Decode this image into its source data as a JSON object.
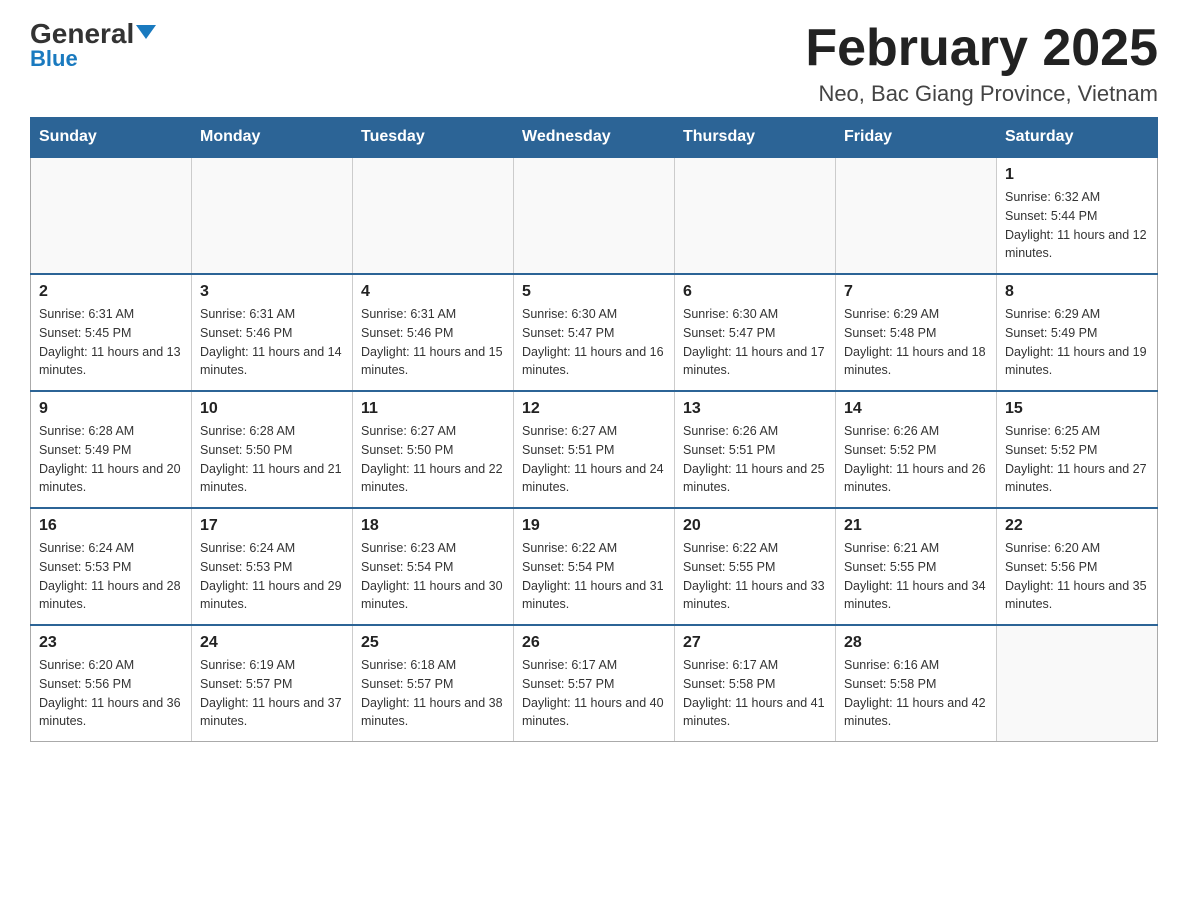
{
  "header": {
    "logo_general": "General",
    "logo_blue": "Blue",
    "title": "February 2025",
    "subtitle": "Neo, Bac Giang Province, Vietnam"
  },
  "days_of_week": [
    "Sunday",
    "Monday",
    "Tuesday",
    "Wednesday",
    "Thursday",
    "Friday",
    "Saturday"
  ],
  "weeks": [
    [
      {
        "day": "",
        "info": ""
      },
      {
        "day": "",
        "info": ""
      },
      {
        "day": "",
        "info": ""
      },
      {
        "day": "",
        "info": ""
      },
      {
        "day": "",
        "info": ""
      },
      {
        "day": "",
        "info": ""
      },
      {
        "day": "1",
        "info": "Sunrise: 6:32 AM\nSunset: 5:44 PM\nDaylight: 11 hours and 12 minutes."
      }
    ],
    [
      {
        "day": "2",
        "info": "Sunrise: 6:31 AM\nSunset: 5:45 PM\nDaylight: 11 hours and 13 minutes."
      },
      {
        "day": "3",
        "info": "Sunrise: 6:31 AM\nSunset: 5:46 PM\nDaylight: 11 hours and 14 minutes."
      },
      {
        "day": "4",
        "info": "Sunrise: 6:31 AM\nSunset: 5:46 PM\nDaylight: 11 hours and 15 minutes."
      },
      {
        "day": "5",
        "info": "Sunrise: 6:30 AM\nSunset: 5:47 PM\nDaylight: 11 hours and 16 minutes."
      },
      {
        "day": "6",
        "info": "Sunrise: 6:30 AM\nSunset: 5:47 PM\nDaylight: 11 hours and 17 minutes."
      },
      {
        "day": "7",
        "info": "Sunrise: 6:29 AM\nSunset: 5:48 PM\nDaylight: 11 hours and 18 minutes."
      },
      {
        "day": "8",
        "info": "Sunrise: 6:29 AM\nSunset: 5:49 PM\nDaylight: 11 hours and 19 minutes."
      }
    ],
    [
      {
        "day": "9",
        "info": "Sunrise: 6:28 AM\nSunset: 5:49 PM\nDaylight: 11 hours and 20 minutes."
      },
      {
        "day": "10",
        "info": "Sunrise: 6:28 AM\nSunset: 5:50 PM\nDaylight: 11 hours and 21 minutes."
      },
      {
        "day": "11",
        "info": "Sunrise: 6:27 AM\nSunset: 5:50 PM\nDaylight: 11 hours and 22 minutes."
      },
      {
        "day": "12",
        "info": "Sunrise: 6:27 AM\nSunset: 5:51 PM\nDaylight: 11 hours and 24 minutes."
      },
      {
        "day": "13",
        "info": "Sunrise: 6:26 AM\nSunset: 5:51 PM\nDaylight: 11 hours and 25 minutes."
      },
      {
        "day": "14",
        "info": "Sunrise: 6:26 AM\nSunset: 5:52 PM\nDaylight: 11 hours and 26 minutes."
      },
      {
        "day": "15",
        "info": "Sunrise: 6:25 AM\nSunset: 5:52 PM\nDaylight: 11 hours and 27 minutes."
      }
    ],
    [
      {
        "day": "16",
        "info": "Sunrise: 6:24 AM\nSunset: 5:53 PM\nDaylight: 11 hours and 28 minutes."
      },
      {
        "day": "17",
        "info": "Sunrise: 6:24 AM\nSunset: 5:53 PM\nDaylight: 11 hours and 29 minutes."
      },
      {
        "day": "18",
        "info": "Sunrise: 6:23 AM\nSunset: 5:54 PM\nDaylight: 11 hours and 30 minutes."
      },
      {
        "day": "19",
        "info": "Sunrise: 6:22 AM\nSunset: 5:54 PM\nDaylight: 11 hours and 31 minutes."
      },
      {
        "day": "20",
        "info": "Sunrise: 6:22 AM\nSunset: 5:55 PM\nDaylight: 11 hours and 33 minutes."
      },
      {
        "day": "21",
        "info": "Sunrise: 6:21 AM\nSunset: 5:55 PM\nDaylight: 11 hours and 34 minutes."
      },
      {
        "day": "22",
        "info": "Sunrise: 6:20 AM\nSunset: 5:56 PM\nDaylight: 11 hours and 35 minutes."
      }
    ],
    [
      {
        "day": "23",
        "info": "Sunrise: 6:20 AM\nSunset: 5:56 PM\nDaylight: 11 hours and 36 minutes."
      },
      {
        "day": "24",
        "info": "Sunrise: 6:19 AM\nSunset: 5:57 PM\nDaylight: 11 hours and 37 minutes."
      },
      {
        "day": "25",
        "info": "Sunrise: 6:18 AM\nSunset: 5:57 PM\nDaylight: 11 hours and 38 minutes."
      },
      {
        "day": "26",
        "info": "Sunrise: 6:17 AM\nSunset: 5:57 PM\nDaylight: 11 hours and 40 minutes."
      },
      {
        "day": "27",
        "info": "Sunrise: 6:17 AM\nSunset: 5:58 PM\nDaylight: 11 hours and 41 minutes."
      },
      {
        "day": "28",
        "info": "Sunrise: 6:16 AM\nSunset: 5:58 PM\nDaylight: 11 hours and 42 minutes."
      },
      {
        "day": "",
        "info": ""
      }
    ]
  ]
}
